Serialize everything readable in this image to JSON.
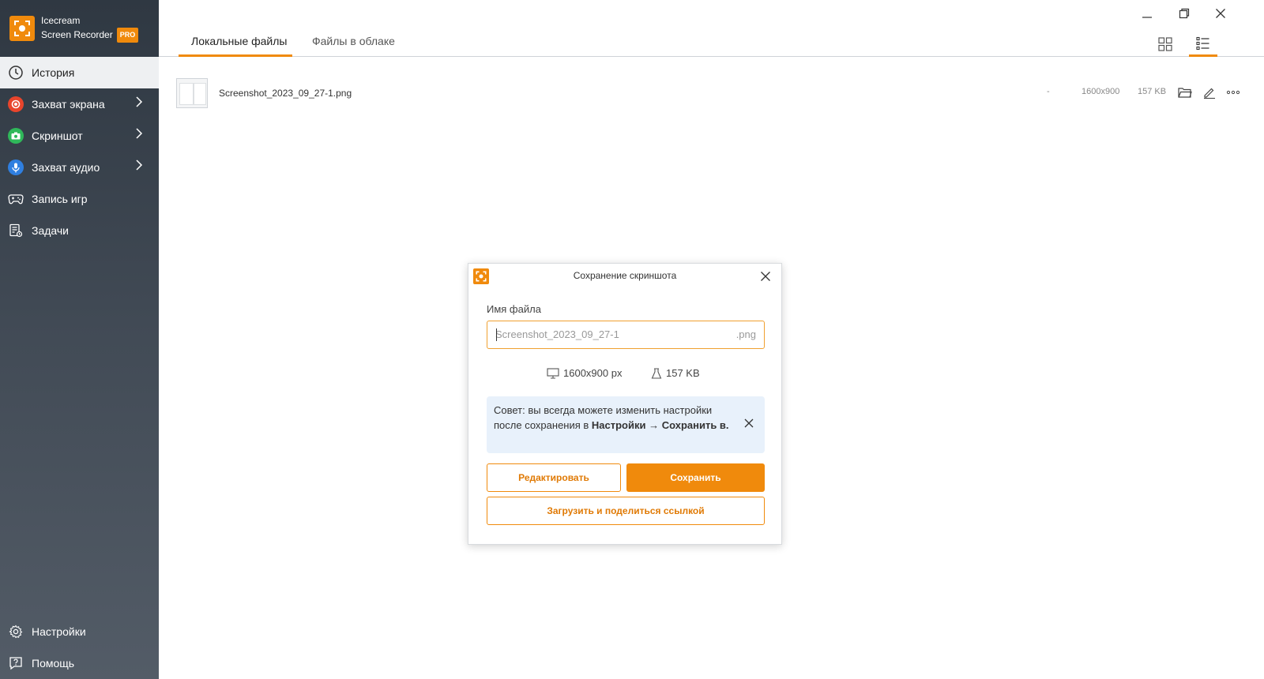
{
  "app": {
    "name_line1": "Icecream",
    "name_line2": "Screen Recorder",
    "badge": "PRO",
    "accent_color": "#f08a0c"
  },
  "sidebar": {
    "items": [
      {
        "label": "История",
        "icon": "clock-icon",
        "active": true
      },
      {
        "label": "Захват экрана",
        "icon": "record-icon",
        "has_submenu": true
      },
      {
        "label": "Скриншот",
        "icon": "camera-icon",
        "has_submenu": true
      },
      {
        "label": "Захват аудио",
        "icon": "microphone-icon",
        "has_submenu": true
      },
      {
        "label": "Запись игр",
        "icon": "gamepad-icon"
      },
      {
        "label": "Задачи",
        "icon": "tasks-icon"
      }
    ],
    "bottom_items": [
      {
        "label": "Настройки",
        "icon": "gear-icon"
      },
      {
        "label": "Помощь",
        "icon": "help-icon"
      }
    ]
  },
  "tabs": [
    {
      "label": "Локальные файлы",
      "active": true
    },
    {
      "label": "Файлы в облаке",
      "active": false
    }
  ],
  "file_list": [
    {
      "name": "Screenshot_2023_09_27-1.png",
      "duration": "-",
      "resolution": "1600x900",
      "size": "157 KB"
    }
  ],
  "dialog": {
    "title": "Сохранение скриншота",
    "filename_label": "Имя файла",
    "filename_value": "Screenshot_2023_09_27-1",
    "filename_ext": ".png",
    "resolution": "1600x900 px",
    "size": "157 KB",
    "tip_text": "Совет: вы всегда можете изменить настройки после сохранения в ",
    "tip_bold": "Настройки → Сохранить в.",
    "edit_button": "Редактировать",
    "save_button": "Сохранить",
    "upload_button": "Загрузить и поделиться ссылкой"
  }
}
